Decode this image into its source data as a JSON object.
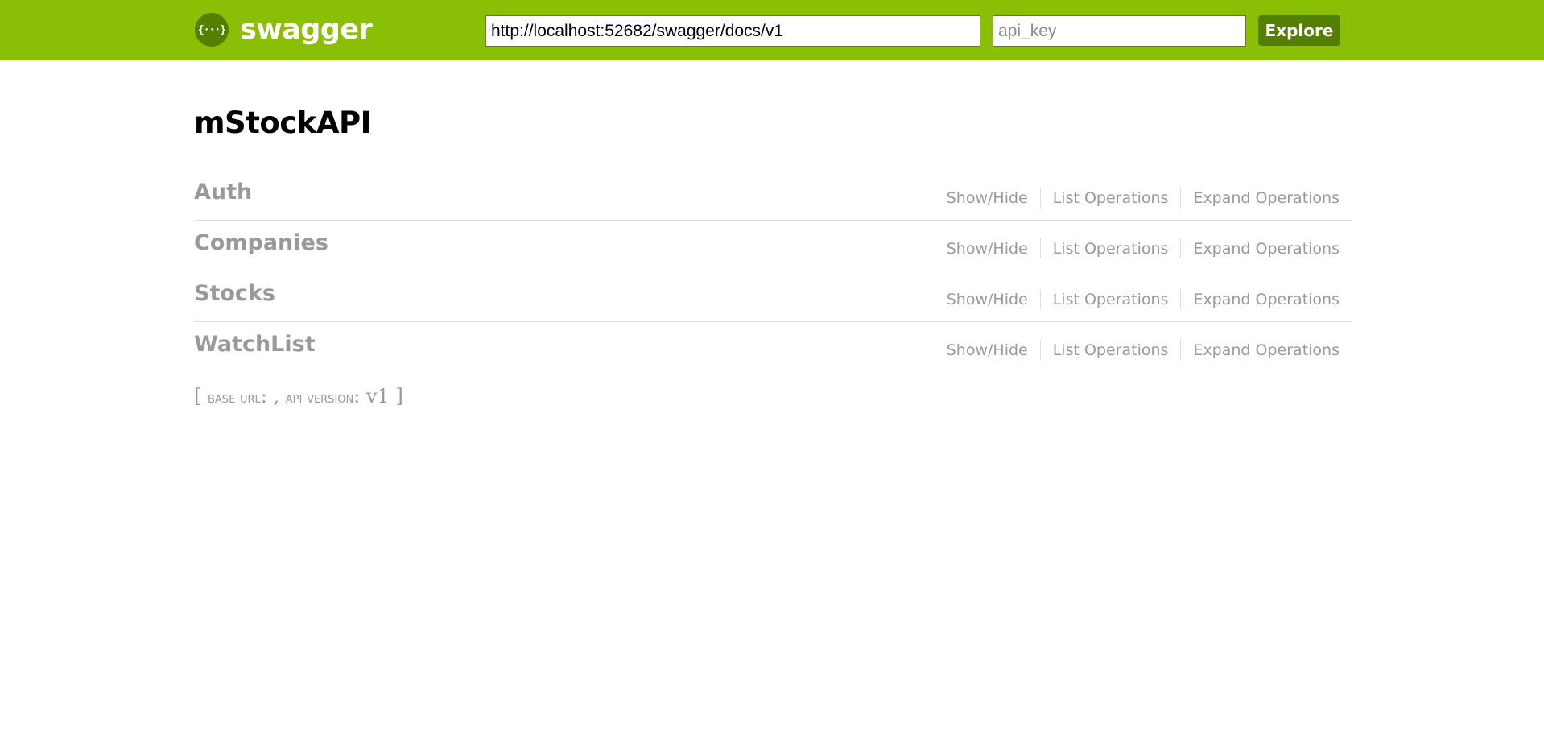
{
  "header": {
    "logo_glyph": "{···}",
    "logo_text": "swagger",
    "url_value": "http://localhost:52682/swagger/docs/v1",
    "api_key_placeholder": "api_key",
    "explore_label": "Explore",
    "background_color": "#89bf04",
    "button_color": "#547f00"
  },
  "api": {
    "title": "mStockAPI"
  },
  "resources": [
    {
      "name": "Auth",
      "show_hide": "Show/Hide",
      "list_ops": "List Operations",
      "expand_ops": "Expand Operations"
    },
    {
      "name": "Companies",
      "show_hide": "Show/Hide",
      "list_ops": "List Operations",
      "expand_ops": "Expand Operations"
    },
    {
      "name": "Stocks",
      "show_hide": "Show/Hide",
      "list_ops": "List Operations",
      "expand_ops": "Expand Operations"
    },
    {
      "name": "WatchList",
      "show_hide": "Show/Hide",
      "list_ops": "List Operations",
      "expand_ops": "Expand Operations"
    }
  ],
  "footer": {
    "open_bracket": "[ ",
    "base_url_label": "base url",
    "base_url_sep": ": , ",
    "api_version_label": "api version",
    "api_version_sep": ": ",
    "api_version_value": "v1",
    "close_bracket": " ]"
  }
}
